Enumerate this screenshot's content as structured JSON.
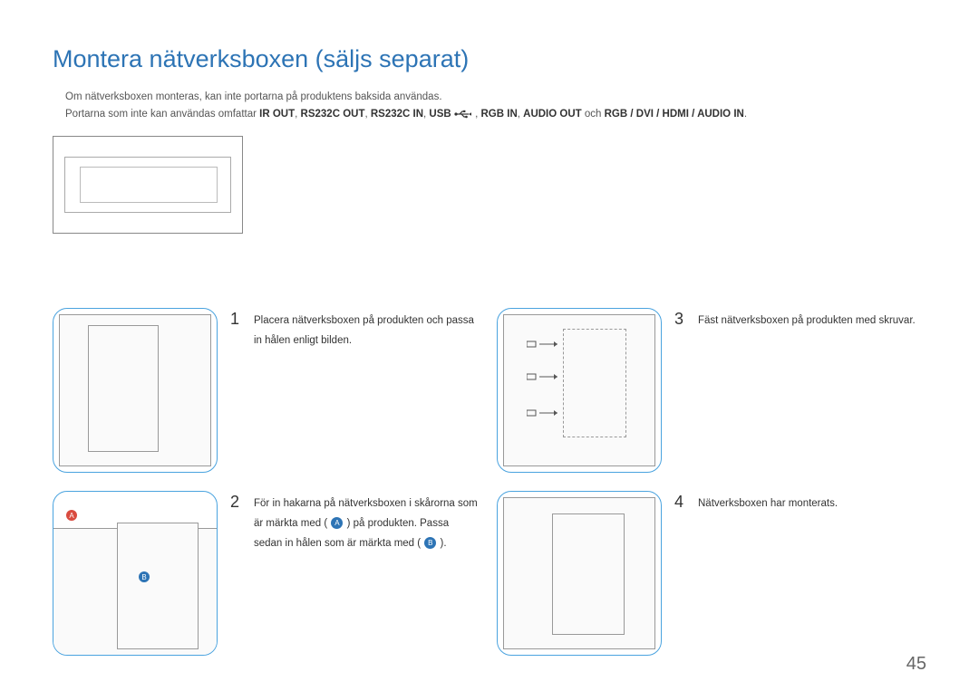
{
  "title": "Montera nätverksboxen (säljs separat)",
  "note": {
    "line1": "Om nätverksboxen monteras, kan inte portarna på produktens baksida användas.",
    "line2_prefix": "Portarna som inte kan användas omfattar ",
    "ports": [
      "IR OUT",
      "RS232C OUT",
      "RS232C IN",
      "USB"
    ],
    "line2_middle1": ", ",
    "ports2": [
      "RGB IN",
      "AUDIO OUT"
    ],
    "line2_middle2": " och ",
    "ports3": "RGB / DVI / HDMI / AUDIO IN",
    "line2_suffix": "."
  },
  "steps": {
    "s1": {
      "num": "1",
      "text": "Placera nätverksboxen på produkten och passa in hålen enligt bilden."
    },
    "s2": {
      "num": "2",
      "t1": "För in hakarna på nätverksboxen i skårorna som är märkta med (",
      "badgeA": "A",
      "t2": ") på produkten. Passa sedan in hålen som är märkta med (",
      "badgeB": "B",
      "t3": ")."
    },
    "s3": {
      "num": "3",
      "text": "Fäst nätverksboxen på produkten med skruvar."
    },
    "s4": {
      "num": "4",
      "text": "Nätverksboxen har monterats."
    }
  },
  "marks": {
    "A": "A",
    "B": "B"
  },
  "page": "45"
}
